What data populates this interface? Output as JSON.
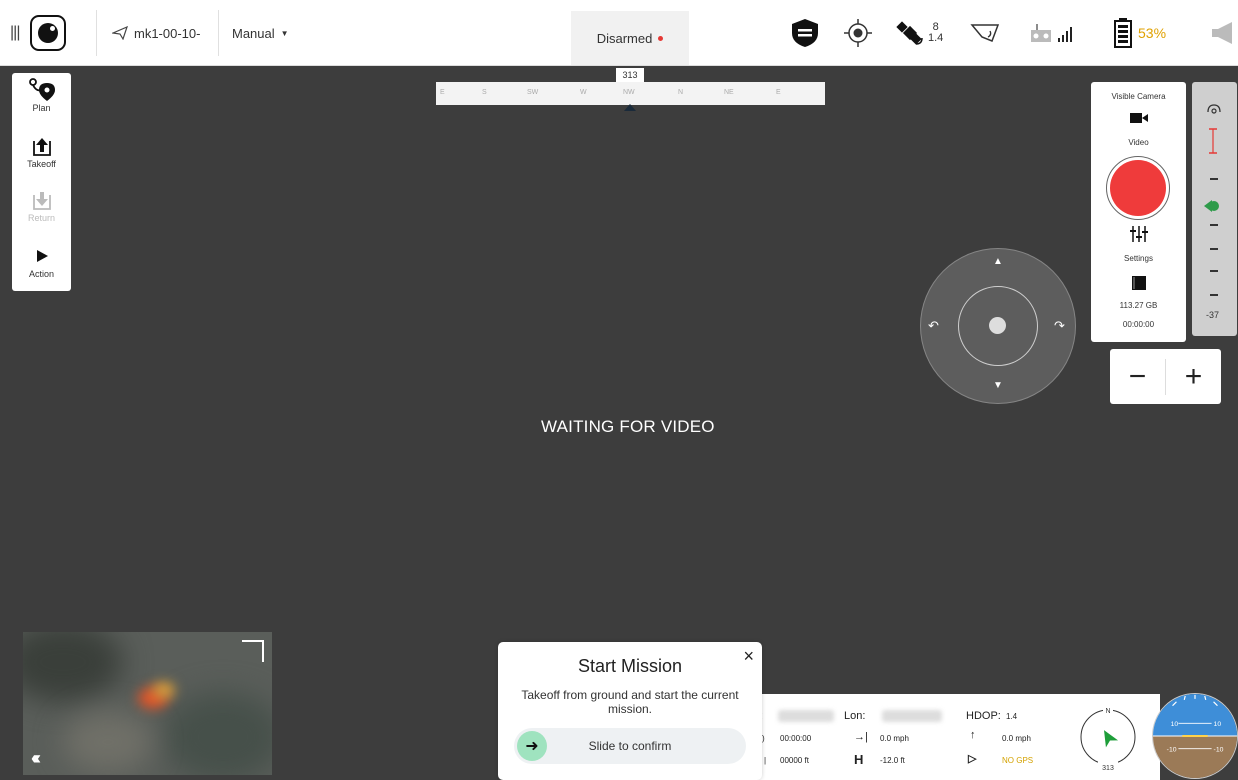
{
  "topbar": {
    "vehicle_name": "mk1-00-10-",
    "flight_mode": "Manual",
    "arm_status": "Disarmed",
    "satellites_count": "8",
    "satellites_hdop": "1.4",
    "battery_percent": "53%"
  },
  "left_panel": {
    "items": [
      {
        "label": "Plan",
        "icon": "plan-icon"
      },
      {
        "label": "Takeoff",
        "icon": "takeoff-icon"
      },
      {
        "label": "Return",
        "icon": "return-icon"
      },
      {
        "label": "Action",
        "icon": "play-icon"
      }
    ]
  },
  "compass": {
    "heading": "313",
    "labels": [
      "E",
      "S",
      "SW",
      "W",
      "NW",
      "N",
      "NE",
      "E"
    ]
  },
  "video": {
    "status_text": "WAITING FOR VIDEO"
  },
  "camera_panel": {
    "title": "Visible Camera",
    "mode": "Video",
    "settings_label": "Settings",
    "storage": "113.27 GB",
    "record_time": "00:00:00"
  },
  "gimbal": {
    "value": "-37"
  },
  "zoom": {
    "minus": "−",
    "plus": "+"
  },
  "mission_popup": {
    "title": "Start Mission",
    "description": "Takeoff from ground and start the current mission.",
    "slider_text": "Slide to confirm",
    "close": "×"
  },
  "telemetry": {
    "lon_label": "Lon:",
    "hdop_label": "HDOP:",
    "hdop_value": "1.4",
    "flight_time": "00:00:00",
    "horizontal_speed": "0.0 mph",
    "vertical_speed": "0.0 mph",
    "distance": "00000 ft",
    "height": "-12.0 ft",
    "gps_status": "NO GPS",
    "h_letter": "H"
  },
  "compass_rose": {
    "north": "N",
    "heading": "313"
  },
  "attitude": {
    "pitch_up_left": "10",
    "pitch_up_right": "10",
    "pitch_down_left": "-10",
    "pitch_down_right": "-10"
  },
  "colors": {
    "background": "#3d3d3d",
    "record": "#ef3b3b",
    "battery": "#e0a100",
    "slider_handle": "#9fe3bf",
    "gps_warning": "#d4a200"
  }
}
